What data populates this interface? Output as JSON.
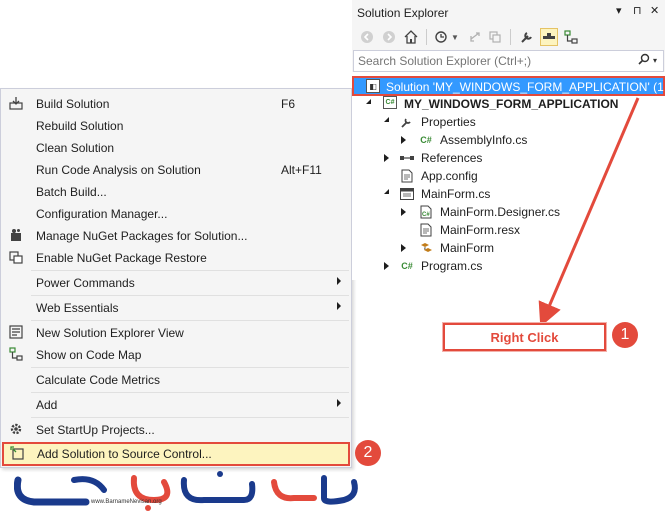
{
  "solution_explorer": {
    "title": "Solution Explorer",
    "title_controls": [
      "▾",
      "⊓",
      "✕"
    ],
    "search_placeholder": "Search Solution Explorer (Ctrl+;)",
    "solution_label": "Solution 'MY_WINDOWS_FORM_APPLICATION' (1 p",
    "tree": [
      {
        "label": "MY_WINDOWS_FORM_APPLICATION",
        "icon": "csharp-project-icon",
        "bold": true
      },
      {
        "label": "Properties",
        "icon": "wrench-icon"
      },
      {
        "label": "AssemblyInfo.cs",
        "icon": "csharp-file-icon"
      },
      {
        "label": "References",
        "icon": "references-icon"
      },
      {
        "label": "App.config",
        "icon": "config-file-icon"
      },
      {
        "label": "MainForm.cs",
        "icon": "form-icon"
      },
      {
        "label": "MainForm.Designer.cs",
        "icon": "designer-file-icon"
      },
      {
        "label": "MainForm.resx",
        "icon": "resx-file-icon"
      },
      {
        "label": "MainForm",
        "icon": "class-icon"
      },
      {
        "label": "Program.cs",
        "icon": "csharp-file-icon"
      }
    ]
  },
  "context_menu": {
    "items": [
      {
        "label": "Build Solution",
        "shortcut": "F6",
        "icon": "build-icon"
      },
      {
        "label": "Rebuild Solution",
        "shortcut": ""
      },
      {
        "label": "Clean Solution",
        "shortcut": ""
      },
      {
        "label": "Run Code Analysis on Solution",
        "shortcut": "Alt+F11"
      },
      {
        "label": "Batch Build...",
        "shortcut": ""
      },
      {
        "label": "Configuration Manager...",
        "shortcut": ""
      },
      {
        "label": "Manage NuGet Packages for Solution...",
        "shortcut": "",
        "icon": "nuget-icon"
      },
      {
        "label": "Enable NuGet Package Restore",
        "shortcut": "",
        "icon": "package-restore-icon"
      },
      {
        "label": "Power Commands",
        "submenu": true
      },
      {
        "label": "Web Essentials",
        "submenu": true
      },
      {
        "label": "New Solution Explorer View",
        "icon": "new-view-icon"
      },
      {
        "label": "Show on Code Map",
        "icon": "code-map-icon"
      },
      {
        "label": "Calculate Code Metrics"
      },
      {
        "label": "Add",
        "submenu": true
      },
      {
        "label": "Set StartUp Projects...",
        "icon": "gear-icon"
      },
      {
        "label": "Add Solution to Source Control...",
        "icon": "source-control-icon",
        "highlighted": true
      }
    ]
  },
  "annotations": {
    "right_click_label": "Right Click",
    "step1": "1",
    "step2": "2",
    "accent_color": "#e34a3c"
  },
  "logo": {
    "url_text": "www.BarnameNevisan.org"
  }
}
